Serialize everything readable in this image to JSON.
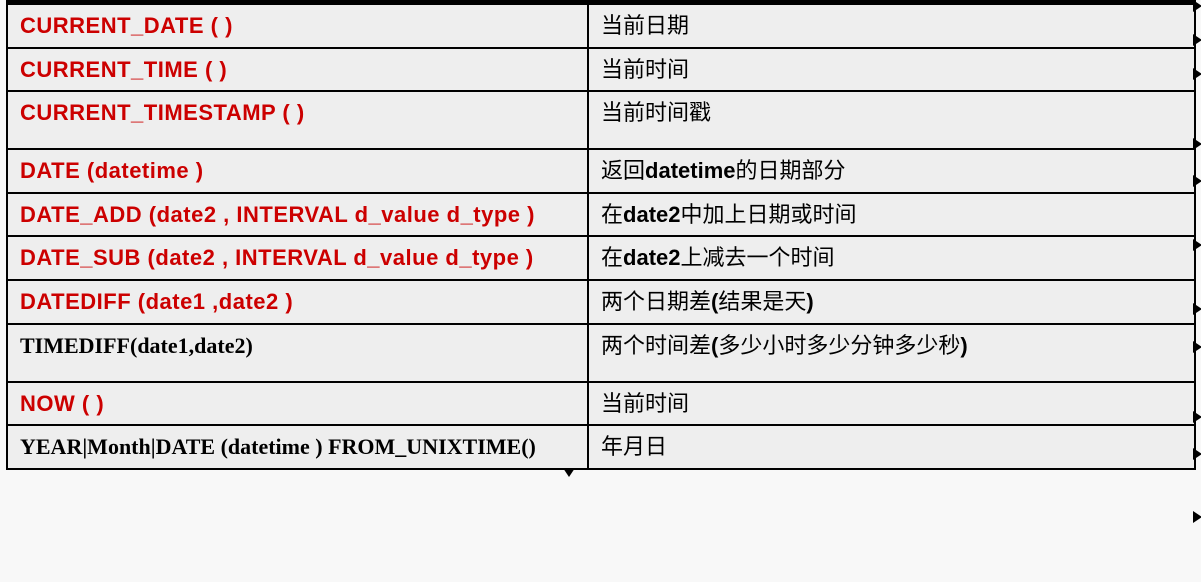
{
  "rows": [
    {
      "fn": "CURRENT_DATE (  )",
      "red": true,
      "desc": [
        {
          "t": "当前日期"
        }
      ],
      "tall": false
    },
    {
      "fn": "CURRENT_TIME (  )",
      "red": true,
      "desc": [
        {
          "t": "当前时间"
        }
      ],
      "tall": false
    },
    {
      "fn": "CURRENT_TIMESTAMP (  )",
      "red": true,
      "desc": [
        {
          "t": "当前时间戳"
        }
      ],
      "tall": true
    },
    {
      "fn": "DATE (datetime )",
      "red": true,
      "desc": [
        {
          "t": "返回"
        },
        {
          "t": "datetime",
          "b": true
        },
        {
          "t": "的日期部分"
        }
      ],
      "tall": false
    },
    {
      "fn": "DATE_ADD (date2 , INTERVAL d_value d_type )",
      "red": true,
      "desc": [
        {
          "t": "在"
        },
        {
          "t": "date2",
          "b": true
        },
        {
          "t": "中加上日期或时间"
        }
      ],
      "tall": false
    },
    {
      "fn": "DATE_SUB (date2 , INTERVAL d_value d_type )",
      "red": true,
      "desc": [
        {
          "t": "在"
        },
        {
          "t": "date2",
          "b": true
        },
        {
          "t": "上减去一个时间"
        }
      ],
      "tall": false
    },
    {
      "fn": "DATEDIFF (date1 ,date2 )",
      "red": true,
      "desc": [
        {
          "t": "两个日期差"
        },
        {
          "t": "(",
          "b": true
        },
        {
          "t": "结果是天"
        },
        {
          "t": ")",
          "b": true
        }
      ],
      "tall": false
    },
    {
      "fn": "TIMEDIFF(date1,date2)",
      "red": false,
      "desc": [
        {
          "t": "两个时间差"
        },
        {
          "t": "(",
          "b": true
        },
        {
          "t": "多少小时多少分钟多少秒"
        },
        {
          "t": ")",
          "b": true
        }
      ],
      "tall": true
    },
    {
      "fn": "NOW (  )",
      "red": true,
      "desc": [
        {
          "t": "当前时间"
        }
      ],
      "tall": false
    },
    {
      "fn": "YEAR|Month|DATE (datetime ) FROM_UNIXTIME()",
      "red": false,
      "desc": [
        {
          "t": "年月日"
        }
      ],
      "tall": false
    }
  ],
  "arrow_tops": [
    -3,
    31,
    65,
    135,
    172,
    236,
    300,
    338,
    408,
    445,
    508
  ]
}
